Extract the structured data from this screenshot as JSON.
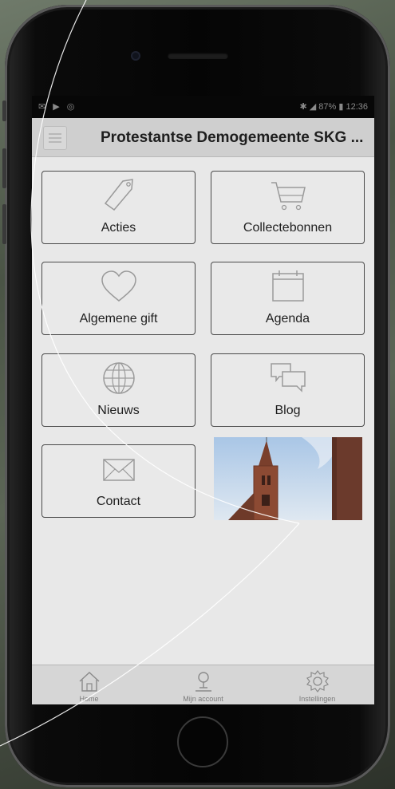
{
  "status_bar": {
    "left_icons": "✉ ▶ ◎",
    "right_text": "✱ ◢ 87% ▮ 12:36"
  },
  "header": {
    "title": "Protestantse Demogemeente SKG ...",
    "menu_icon": "hamburger-icon"
  },
  "tiles": [
    {
      "label": "Acties",
      "icon": "tag-icon"
    },
    {
      "label": "Collectebonnen",
      "icon": "cart-icon"
    },
    {
      "label": "Algemene gift",
      "icon": "heart-icon"
    },
    {
      "label": "Agenda",
      "icon": "calendar-icon"
    },
    {
      "label": "Nieuws",
      "icon": "globe-icon"
    },
    {
      "label": "Blog",
      "icon": "chat-bubbles-icon"
    },
    {
      "label": "Contact",
      "icon": "envelope-icon"
    }
  ],
  "tabbar": {
    "tabs": [
      {
        "label": "Home",
        "icon": "home-icon"
      },
      {
        "label": "Mijn account",
        "icon": "user-icon"
      },
      {
        "label": "Instellingen",
        "icon": "gear-icon"
      }
    ]
  },
  "colors": {
    "screen_bg": "#e8e8e8",
    "header_bg": "#cfcfcf",
    "tile_border": "#4a4a4a",
    "tabbar_bg": "#d6d6d6",
    "phone_body": "#050505"
  }
}
